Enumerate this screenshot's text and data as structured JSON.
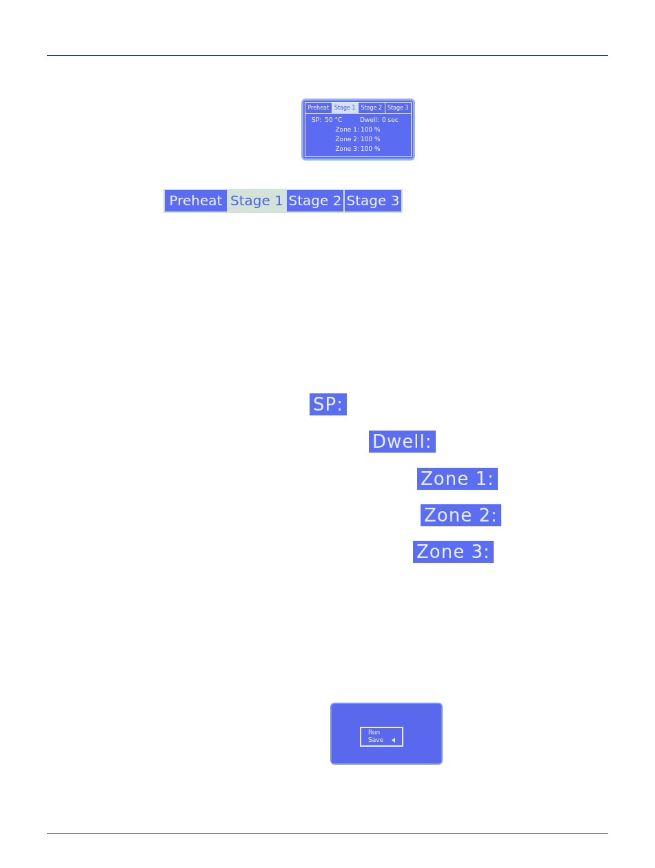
{
  "lcd_screen_top": {
    "tabs": [
      {
        "label": "Preheat",
        "selected": false
      },
      {
        "label": "Stage 1",
        "selected": true
      },
      {
        "label": "Stage 2",
        "selected": false
      },
      {
        "label": "Stage 3",
        "selected": false
      }
    ],
    "setpoint": {
      "label": "SP:",
      "value": "50 °C"
    },
    "dwell": {
      "label": "Dwell:",
      "value": "0 sec"
    },
    "zones": [
      {
        "label": "Zone 1:",
        "value": "100 %"
      },
      {
        "label": "Zone 2:",
        "value": "100 %"
      },
      {
        "label": "Zone 3:",
        "value": "100 %"
      }
    ]
  },
  "tab_strip_closeup": {
    "tabs": [
      {
        "label": "Preheat",
        "selected": false
      },
      {
        "label": "Stage 1",
        "selected": true
      },
      {
        "label": "Stage 2",
        "selected": false
      },
      {
        "label": "Stage 3",
        "selected": false
      }
    ]
  },
  "label_closeups": [
    "SP:",
    "Dwell:",
    "Zone 1:",
    "Zone 2:",
    "Zone 3:"
  ],
  "lcd_screen_bottom": {
    "menu": [
      {
        "label": "Run",
        "selected": false
      },
      {
        "label": "Save",
        "selected": true
      }
    ]
  }
}
